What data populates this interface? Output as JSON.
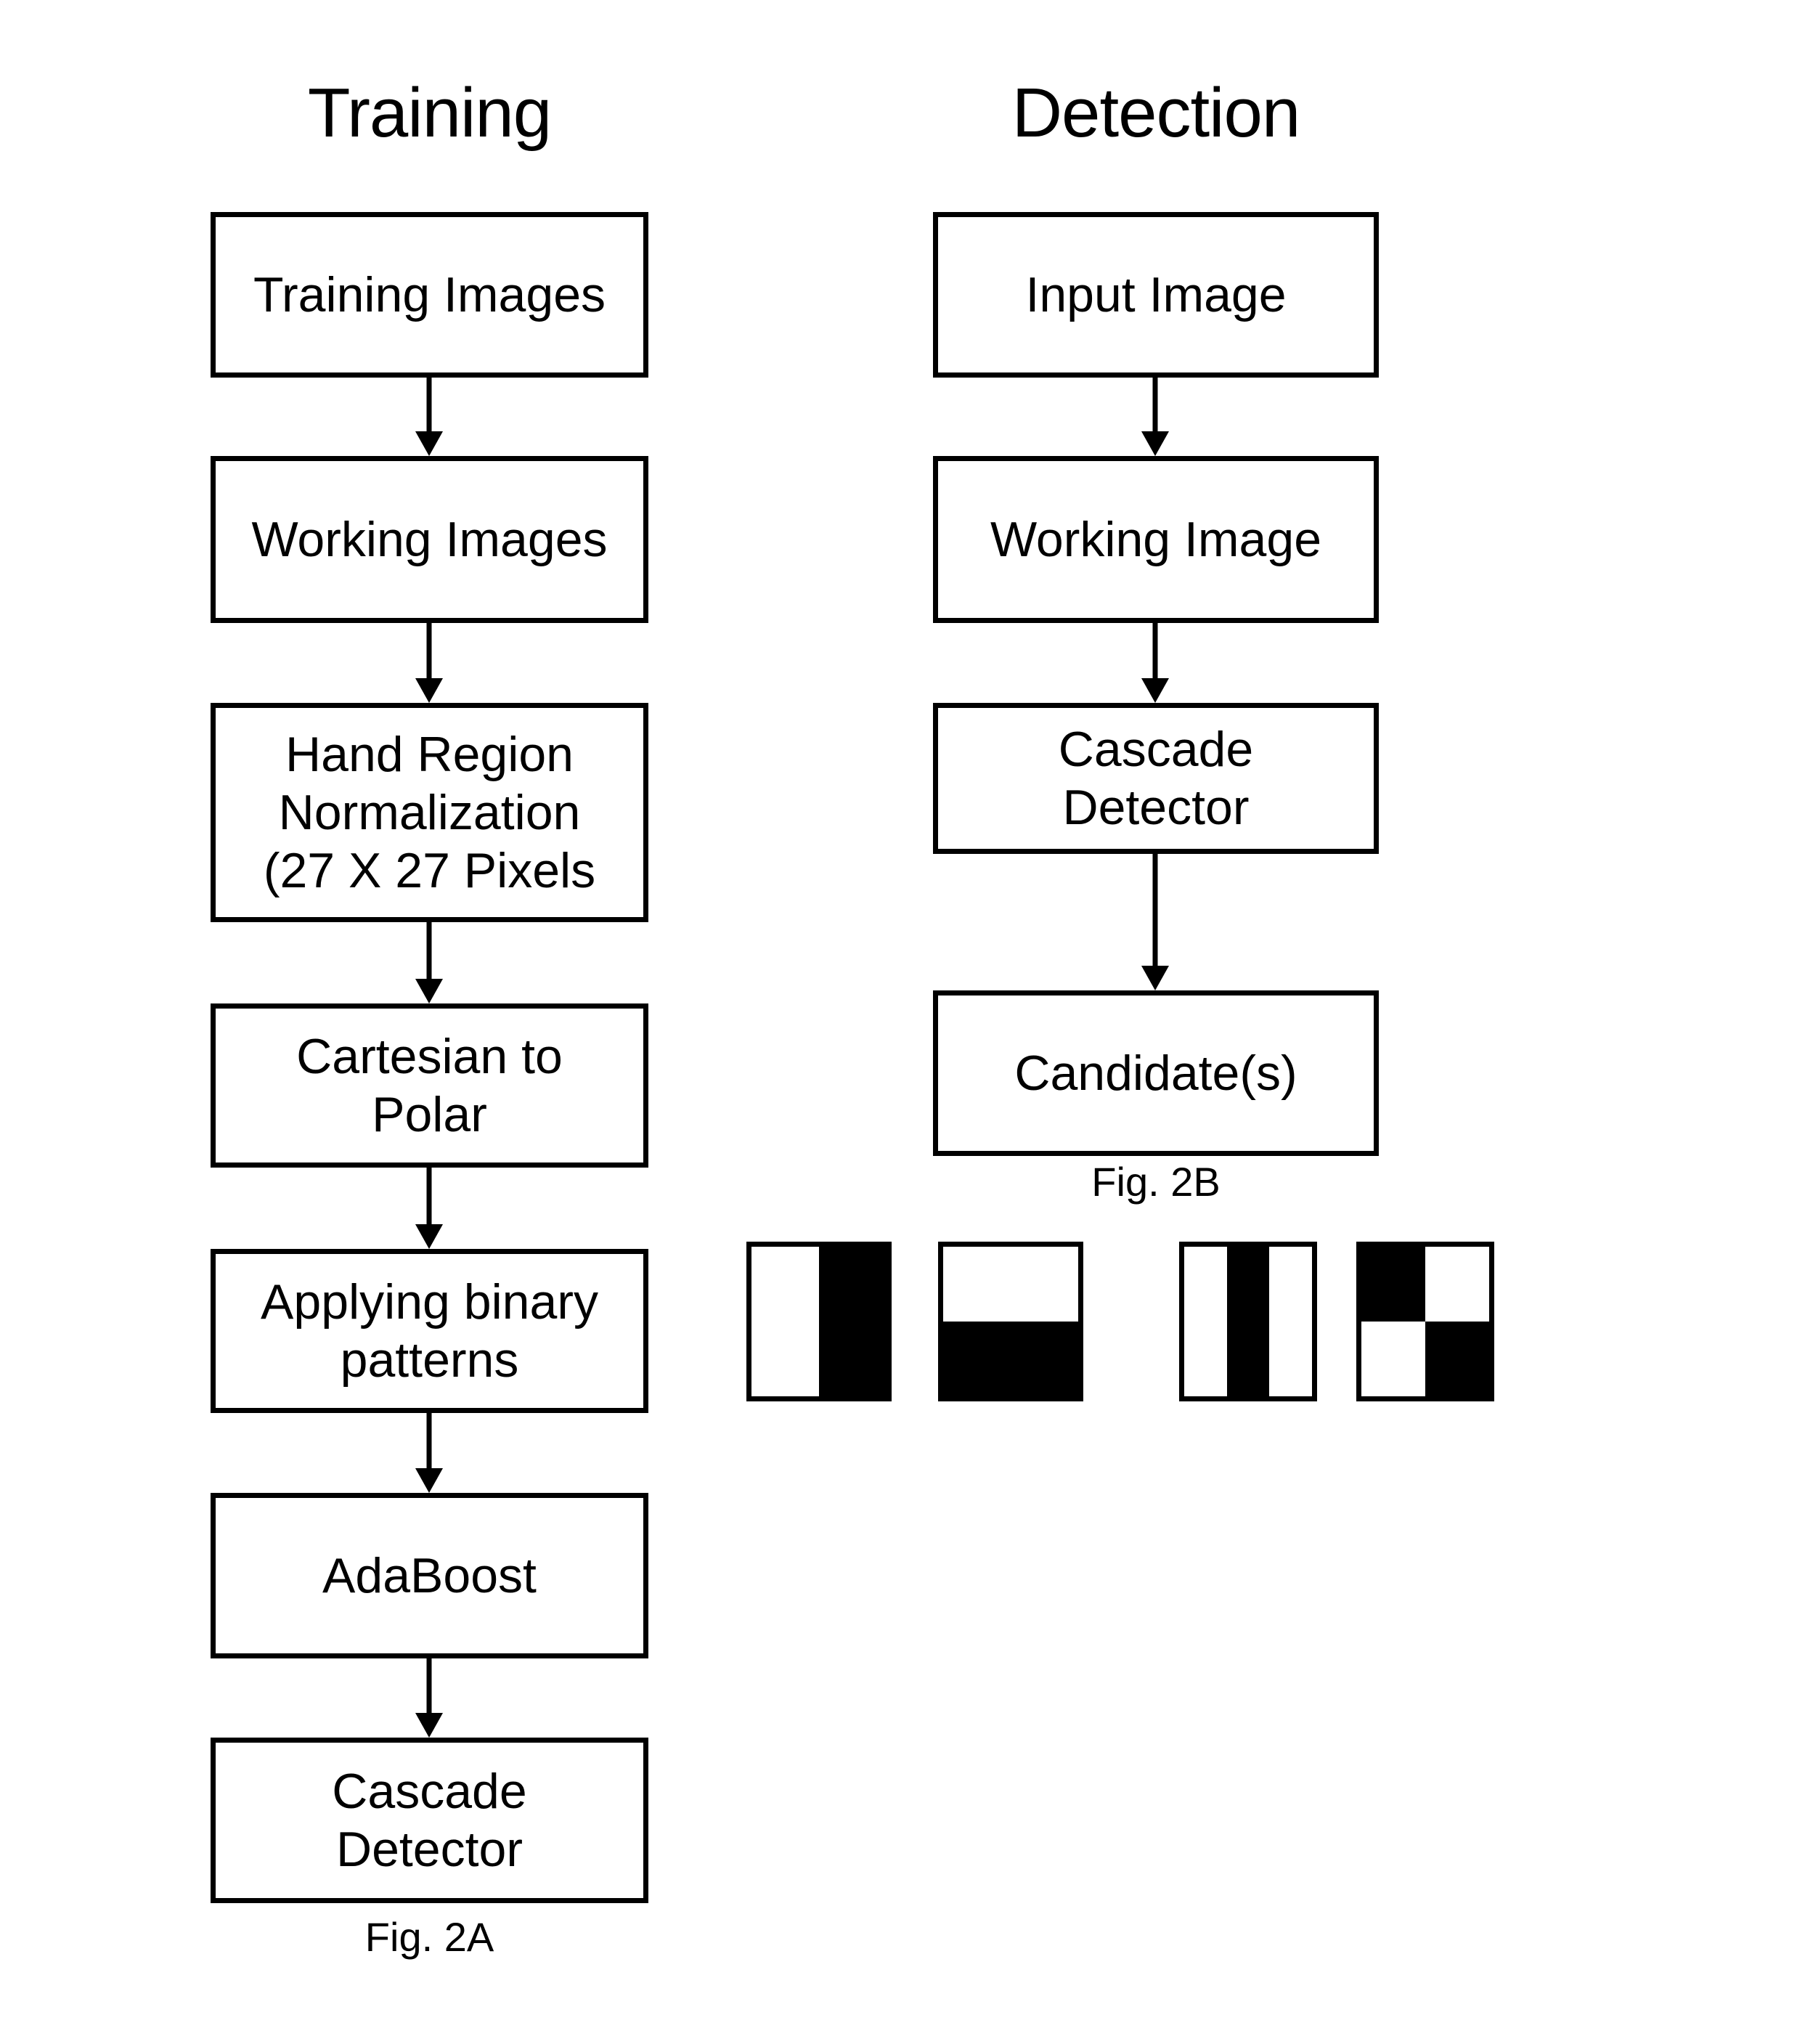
{
  "figure": {
    "columns": [
      {
        "id": "training",
        "title": "Training",
        "caption": "Fig. 2A",
        "steps": [
          {
            "label": "Training Images"
          },
          {
            "label": "Working Images"
          },
          {
            "label": "Hand Region\nNormalization\n(27 X 27 Pixels"
          },
          {
            "label": "Cartesian to\nPolar"
          },
          {
            "label": "Applying binary\npatterns"
          },
          {
            "label": "AdaBoost"
          },
          {
            "label": "Cascade\nDetector"
          }
        ]
      },
      {
        "id": "detection",
        "title": "Detection",
        "caption": "Fig. 2B",
        "steps": [
          {
            "label": "Input Image"
          },
          {
            "label": "Working Image"
          },
          {
            "label": "Cascade\nDetector"
          },
          {
            "label": "Candidate(s)"
          }
        ]
      }
    ],
    "haar_features": [
      {
        "name": "two-rectangle-vertical-edge-feature",
        "pattern": "white-left-black-right"
      },
      {
        "name": "two-rectangle-horizontal-edge-feature",
        "pattern": "white-top-black-bottom"
      },
      {
        "name": "three-rectangle-vertical-line-feature",
        "pattern": "white-black-white-columns"
      },
      {
        "name": "four-rectangle-diagonal-feature",
        "pattern": "black-white-over-white-black"
      }
    ],
    "colors": {
      "ink": "#000000",
      "paper": "#ffffff"
    }
  }
}
